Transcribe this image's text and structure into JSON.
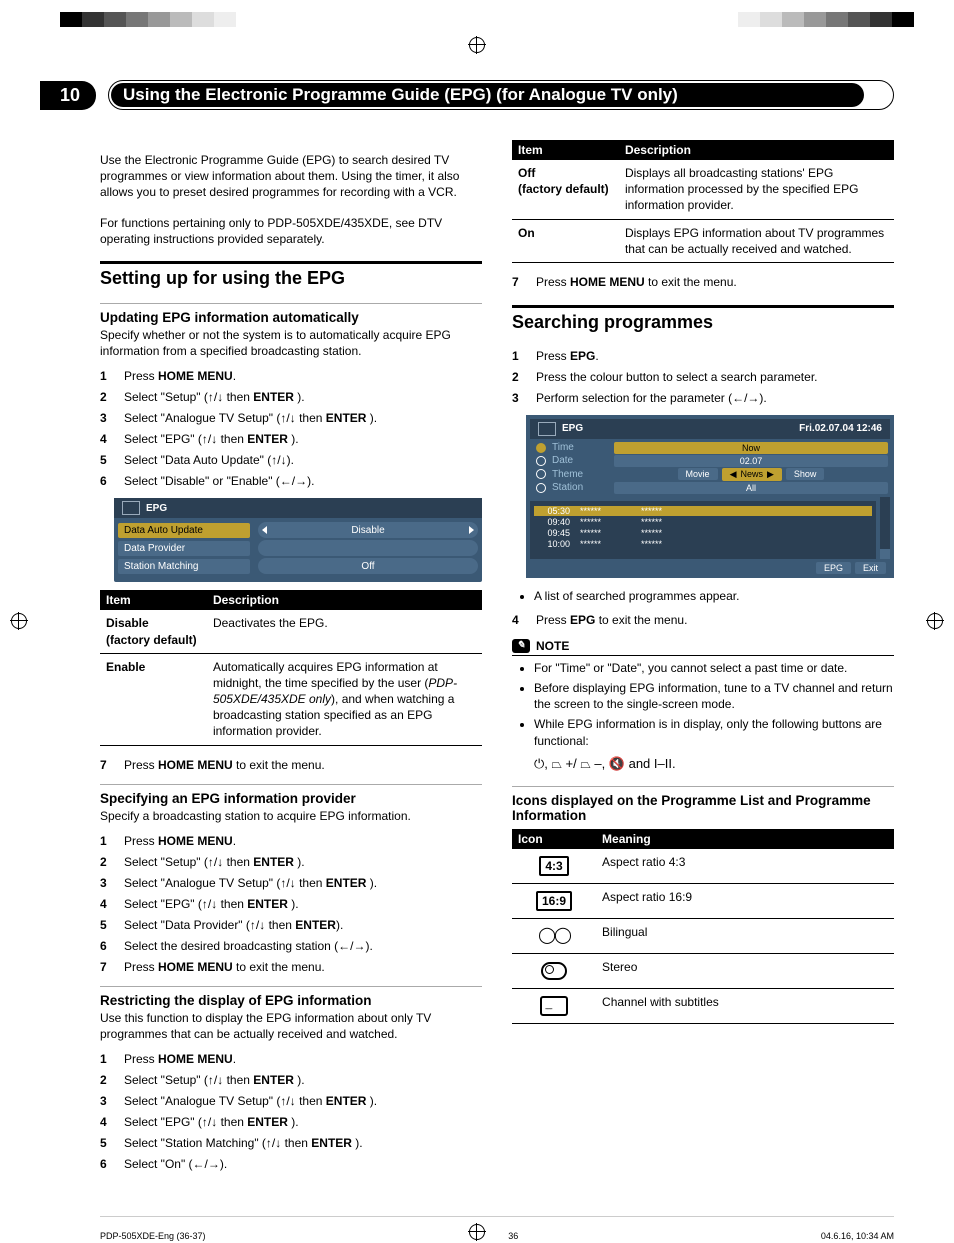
{
  "chapter": "10",
  "chapter_title": "Using the Electronic Programme Guide (EPG) (for Analogue TV only)",
  "intro1": "Use the Electronic Programme Guide (EPG) to search desired TV programmes or view information about them. Using the timer, it also allows you to preset desired programmes for recording with a VCR.",
  "intro2": "For functions pertaining only to PDP-505XDE/435XDE, see DTV operating instructions provided separately.",
  "section1": "Setting up for using the EPG",
  "sub1": "Updating EPG information automatically",
  "sub1_desc": "Specify whether or not the system is to automatically acquire EPG information from a specified broadcasting station.",
  "steps1": [
    {
      "pre": "Press ",
      "key": "HOME MENU",
      "post": "."
    },
    {
      "pre": "Select \"Setup\" (",
      "arrows": "↑/↓",
      "mid": " then ",
      "key": "ENTER",
      "post": " )."
    },
    {
      "pre": "Select \"Analogue TV Setup\" (",
      "arrows": "↑/↓",
      "mid": " then ",
      "key": "ENTER",
      "post": " )."
    },
    {
      "pre": "Select \"EPG\" (",
      "arrows": "↑/↓",
      "mid": " then ",
      "key": "ENTER",
      "post": " )."
    },
    {
      "pre": "Select \"Data Auto Update\"  (",
      "arrows": "↑/↓",
      "post": ")."
    },
    {
      "pre": "Select \"Disable\" or \"Enable\"  (",
      "arrows": "←/→",
      "post": ")."
    }
  ],
  "epg_panel": {
    "title": "EPG",
    "rows": [
      {
        "label": "Data Auto Update",
        "value": "Disable",
        "arrows": true,
        "sel": true
      },
      {
        "label": "Data Provider",
        "value": "",
        "arrows": false,
        "sel": false
      },
      {
        "label": "Station Matching",
        "value": "Off",
        "arrows": false,
        "sel": false
      }
    ]
  },
  "table1": {
    "h1": "Item",
    "h2": "Description",
    "rows": [
      {
        "item": "Disable (factory default)",
        "desc": "Deactivates the EPG."
      },
      {
        "item": "Enable",
        "desc": "Automatically acquires EPG information at midnight, the time specified by the user (PDP-505XDE/435XDE only), and when watching a broadcasting station specified as an EPG information provider."
      }
    ]
  },
  "step7a": {
    "pre": "Press ",
    "key": "HOME MENU",
    "post": " to exit the menu."
  },
  "sub2": "Specifying an EPG information provider",
  "sub2_desc": "Specify a broadcasting station to acquire EPG information.",
  "steps2": [
    {
      "pre": "Press ",
      "key": "HOME MENU",
      "post": "."
    },
    {
      "pre": "Select \"Setup\" (",
      "arrows": "↑/↓",
      "mid": " then ",
      "key": "ENTER",
      "post": " )."
    },
    {
      "pre": "Select \"Analogue TV Setup\" (",
      "arrows": "↑/↓",
      "mid": " then ",
      "key": "ENTER",
      "post": " )."
    },
    {
      "pre": "Select \"EPG\" (",
      "arrows": "↑/↓",
      "mid": " then ",
      "key": "ENTER",
      "post": " )."
    },
    {
      "pre": "Select \"Data Provider\" (",
      "arrows": "↑/↓",
      "mid": " then ",
      "key": "ENTER",
      "post": ")."
    },
    {
      "pre": "Select the desired broadcasting station (",
      "arrows": "←/→",
      "post": ")."
    },
    {
      "pre": "Press ",
      "key": "HOME MENU",
      "post": " to exit the menu."
    }
  ],
  "sub3": "Restricting the display of EPG information",
  "sub3_desc": "Use this function to display the EPG information about only TV programmes that can be actually received and watched.",
  "steps3": [
    {
      "pre": "Press ",
      "key": "HOME MENU",
      "post": "."
    },
    {
      "pre": "Select \"Setup\" (",
      "arrows": "↑/↓",
      "mid": " then ",
      "key": "ENTER",
      "post": " )."
    },
    {
      "pre": "Select \"Analogue TV Setup\" (",
      "arrows": "↑/↓",
      "mid": " then ",
      "key": "ENTER",
      "post": " )."
    },
    {
      "pre": "Select \"EPG\" (",
      "arrows": "↑/↓",
      "mid": " then ",
      "key": "ENTER",
      "post": " )."
    },
    {
      "pre": "Select \"Station Matching\" (",
      "arrows": "↑/↓",
      "mid": " then ",
      "key": "ENTER",
      "post": " )."
    },
    {
      "pre": "Select \"On\" (",
      "arrows": "←/→",
      "post": ")."
    }
  ],
  "table2": {
    "h1": "Item",
    "h2": "Description",
    "rows": [
      {
        "item": "Off (factory default)",
        "desc": "Displays all broadcasting stations' EPG information processed by the specified EPG information provider."
      },
      {
        "item": "On",
        "desc": "Displays EPG information about TV programmes that can be actually received and watched."
      }
    ]
  },
  "step7b": {
    "pre": "Press ",
    "key": "HOME MENU",
    "post": " to exit the menu."
  },
  "section2": "Searching programmes",
  "steps4": [
    {
      "pre": "Press ",
      "key": "EPG",
      "post": "."
    },
    {
      "pre": "Press the colour button to select a search parameter."
    },
    {
      "pre": "Perform selection for the parameter (",
      "arrows": "←/→",
      "post": ")."
    }
  ],
  "epg_search": {
    "title": "EPG",
    "datetime": "Fri.02.07.04 12:46",
    "filters": [
      {
        "label": "Time",
        "radio": true,
        "tags": [
          {
            "t": "Now",
            "sel": true,
            "wide": true
          }
        ]
      },
      {
        "label": "Date",
        "radio": false,
        "tags": [
          {
            "t": "02.07",
            "sel": false,
            "wide": true
          }
        ]
      },
      {
        "label": "Theme",
        "radio": false,
        "tags": [
          {
            "t": "Movie"
          },
          {
            "t": "News",
            "sel": true,
            "arrows": true
          },
          {
            "t": "Show"
          }
        ]
      },
      {
        "label": "Station",
        "radio": false,
        "tags": [
          {
            "t": "All",
            "sel": false,
            "wide": true
          }
        ]
      }
    ],
    "progs": [
      {
        "t": "05:30",
        "a": "******",
        "b": "******"
      },
      {
        "t": "09:40",
        "a": "******",
        "b": "******"
      },
      {
        "t": "09:45",
        "a": "******",
        "b": "******"
      },
      {
        "t": "10:00",
        "a": "******",
        "b": "******"
      }
    ],
    "fbtn1": "EPG",
    "fbtn2": "Exit"
  },
  "after_search_bullet": "A list of searched programmes appear.",
  "step4b": {
    "pre": "Press ",
    "key": "EPG",
    "post": " to exit the menu."
  },
  "note_title": "NOTE",
  "notes": [
    "For \"Time\" or \"Date\", you cannot select a past time or date.",
    "Before displaying EPG information, tune to a TV channel and return the screen to the single-screen mode.",
    "While EPG information is in display, only the following buttons are functional:"
  ],
  "func_line": "⏻, ⏢ +/ ⏢ –, 🔇 and I–II.",
  "sub4": "Icons displayed on the Programme List and Programme Information",
  "icon_table": {
    "h1": "Icon",
    "h2": "Meaning",
    "rows": [
      {
        "icon": "4:3",
        "meaning": "Aspect ratio 4:3"
      },
      {
        "icon": "16:9",
        "meaning": "Aspect ratio 16:9"
      },
      {
        "icon": "bilingual",
        "meaning": "Bilingual"
      },
      {
        "icon": "stereo",
        "meaning": "Stereo"
      },
      {
        "icon": "subtitle",
        "meaning": "Channel with subtitles"
      }
    ]
  },
  "page_num": "36",
  "page_lang": "En",
  "footer_left": "PDP-505XDE-Eng (36-37)",
  "footer_mid": "36",
  "footer_right": "04.6.16, 10:34 AM",
  "color_bar_left": [
    "#000",
    "#333",
    "#555",
    "#777",
    "#999",
    "#bbb",
    "#ddd",
    "#eee"
  ],
  "color_bar_right": [
    "#eee",
    "#ddd",
    "#bbb",
    "#999",
    "#777",
    "#555",
    "#333",
    "#000"
  ]
}
